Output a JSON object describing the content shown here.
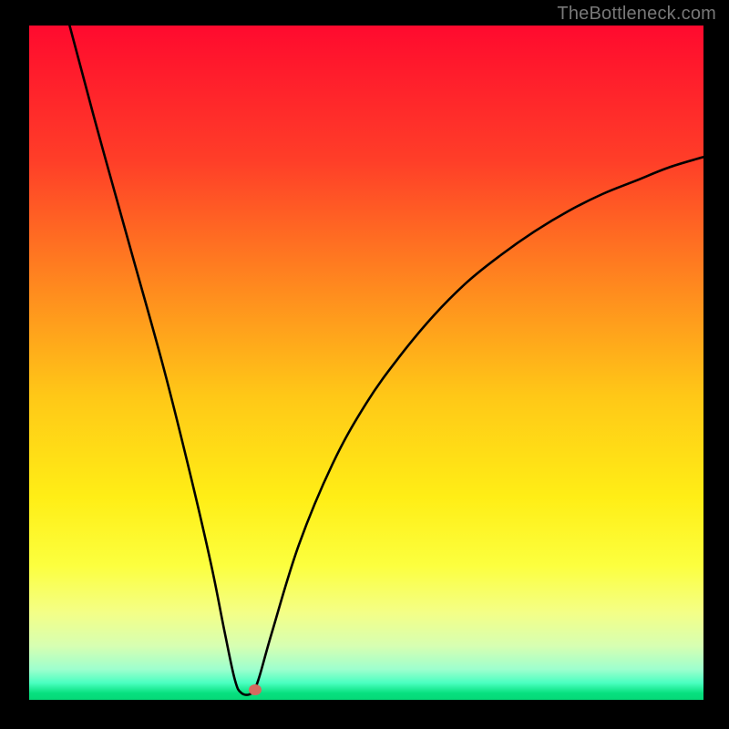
{
  "watermark": "TheBottleneck.com",
  "gradient": {
    "stops": [
      {
        "pos": 0.0,
        "color": "#ff0a2e"
      },
      {
        "pos": 0.2,
        "color": "#ff3e28"
      },
      {
        "pos": 0.4,
        "color": "#ff8e1e"
      },
      {
        "pos": 0.55,
        "color": "#ffc817"
      },
      {
        "pos": 0.7,
        "color": "#ffee16"
      },
      {
        "pos": 0.8,
        "color": "#fcff3e"
      },
      {
        "pos": 0.87,
        "color": "#f4ff86"
      },
      {
        "pos": 0.92,
        "color": "#d7ffb2"
      },
      {
        "pos": 0.955,
        "color": "#9dffce"
      },
      {
        "pos": 0.975,
        "color": "#4affc0"
      },
      {
        "pos": 0.99,
        "color": "#07e07f"
      },
      {
        "pos": 1.0,
        "color": "#06d877"
      }
    ]
  },
  "chart_data": {
    "type": "line",
    "title": "",
    "xlabel": "",
    "ylabel": "",
    "xlim": [
      0,
      100
    ],
    "ylim": [
      0,
      100
    ],
    "series": [
      {
        "name": "bottleneck-curve",
        "x": [
          6,
          10,
          15,
          20,
          24,
          27,
          29,
          30.5,
          31.5,
          33,
          34,
          36,
          40,
          45,
          50,
          55,
          60,
          65,
          70,
          75,
          80,
          85,
          90,
          95,
          100
        ],
        "values": [
          100,
          85,
          67,
          49,
          33,
          20,
          10,
          3,
          1,
          1,
          3,
          10,
          23,
          35,
          44,
          51,
          57,
          62,
          66,
          69.5,
          72.5,
          75,
          77,
          79,
          80.5
        ]
      }
    ],
    "marker": {
      "x": 33.5,
      "y": 1.5,
      "color": "#d46a5f"
    }
  }
}
